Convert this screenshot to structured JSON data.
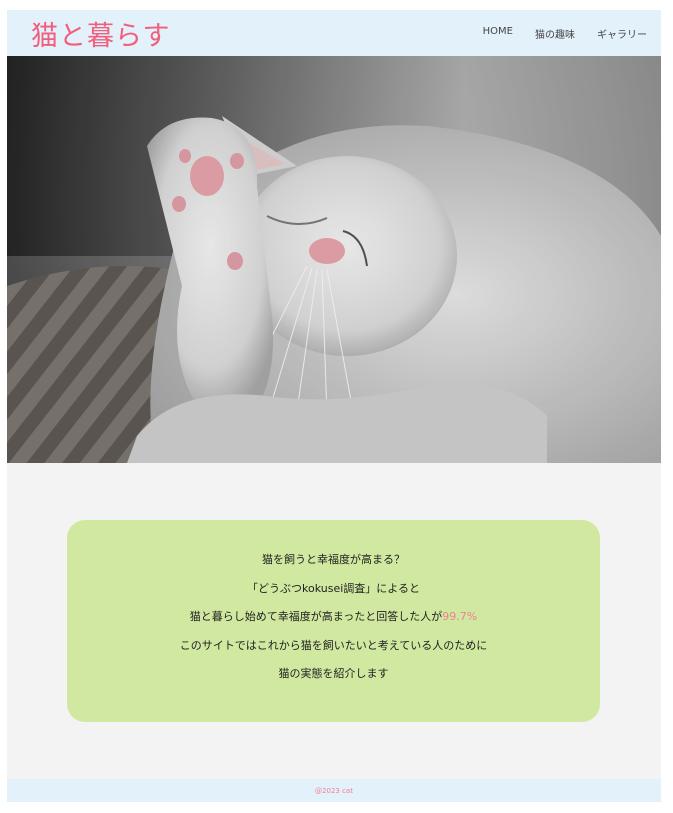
{
  "header": {
    "logo": "猫と暮らす",
    "nav": [
      {
        "label": "HOME"
      },
      {
        "label": "猫の趣味"
      },
      {
        "label": "ギャラリー"
      }
    ]
  },
  "hero": {
    "image": "sleeping-white-cat-photo"
  },
  "message": {
    "line1": "猫を飼うと幸福度が高まる？",
    "line2": "「どうぶつkokusei調査」によると",
    "line3_prefix": "猫と暮らし始めて幸福度が高まったと回答した人が",
    "line3_highlight": "99.7%",
    "line4": "このサイトではこれから猫を飼いたいと考えている人のために",
    "line5": "猫の実態を紹介します"
  },
  "footer": {
    "copyright": "@2023 cat"
  },
  "colors": {
    "accent": "#f0607e",
    "header_bg": "#e3f1fb",
    "card_bg": "#d0e8a0",
    "page_bg": "#f3f3f3"
  }
}
